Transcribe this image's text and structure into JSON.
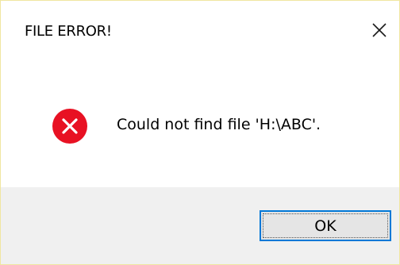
{
  "window": {
    "title": "FILE ERROR!",
    "close_icon": "close-icon"
  },
  "message": {
    "icon": "error-icon",
    "text": "Could not find file 'H:\\ABC'."
  },
  "buttons": {
    "ok_label": "OK"
  },
  "colors": {
    "error_red": "#e81123",
    "focus_blue": "#0078d7",
    "footer_bg": "#f0f0f0"
  }
}
